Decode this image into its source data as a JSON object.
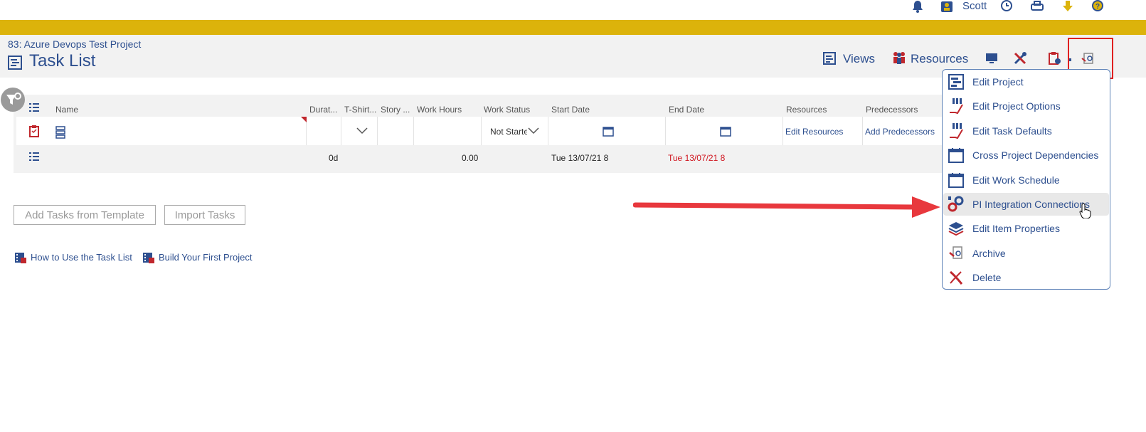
{
  "topbar": {
    "user_name": "Scott",
    "icons": [
      "bell-icon",
      "user-badge-icon",
      "clock-icon",
      "printer-icon",
      "download-icon",
      "help-icon"
    ]
  },
  "header": {
    "breadcrumb": "83: Azure Devops Test Project",
    "title": "Task List",
    "toolbar": {
      "views_label": "Views",
      "resources_label": "Resources"
    }
  },
  "grid": {
    "columns": [
      "Name",
      "Durat...",
      "T-Shirt...",
      "Story ...",
      "Work Hours",
      "Work Status",
      "Start Date",
      "End Date",
      "Resources",
      "Predecessors"
    ],
    "row": {
      "work_status": "Not Starte",
      "resources_link": "Edit Resources",
      "predecessors_link": "Add Predecessors"
    },
    "summary": {
      "duration": "0d",
      "work_hours": "0.00",
      "start_date": "Tue 13/07/21 8",
      "end_date": "Tue 13/07/21 8"
    }
  },
  "actions": {
    "add_from_template": "Add Tasks from Template",
    "import_tasks": "Import Tasks"
  },
  "help_links": {
    "how_to": "How to Use the Task List",
    "first_project": "Build Your First Project"
  },
  "menu": {
    "items": [
      {
        "label": "Edit Project",
        "icon": "gantt-icon"
      },
      {
        "label": "Edit Project Options",
        "icon": "options-icon"
      },
      {
        "label": "Edit Task Defaults",
        "icon": "task-defaults-icon"
      },
      {
        "label": "Cross Project Dependencies",
        "icon": "calendar-icon"
      },
      {
        "label": "Edit Work Schedule",
        "icon": "calendar-icon"
      },
      {
        "label": "PI Integration Connections",
        "icon": "gears-icon"
      },
      {
        "label": "Edit Item Properties",
        "icon": "layers-icon"
      },
      {
        "label": "Archive",
        "icon": "archive-icon"
      },
      {
        "label": "Delete",
        "icon": "delete-icon"
      }
    ],
    "hovered_index": 5
  },
  "colors": {
    "brand_yellow": "#DCB30B",
    "link_blue": "#2d4f8f",
    "highlight_red": "#e02020",
    "end_date_red": "#d0141e"
  }
}
